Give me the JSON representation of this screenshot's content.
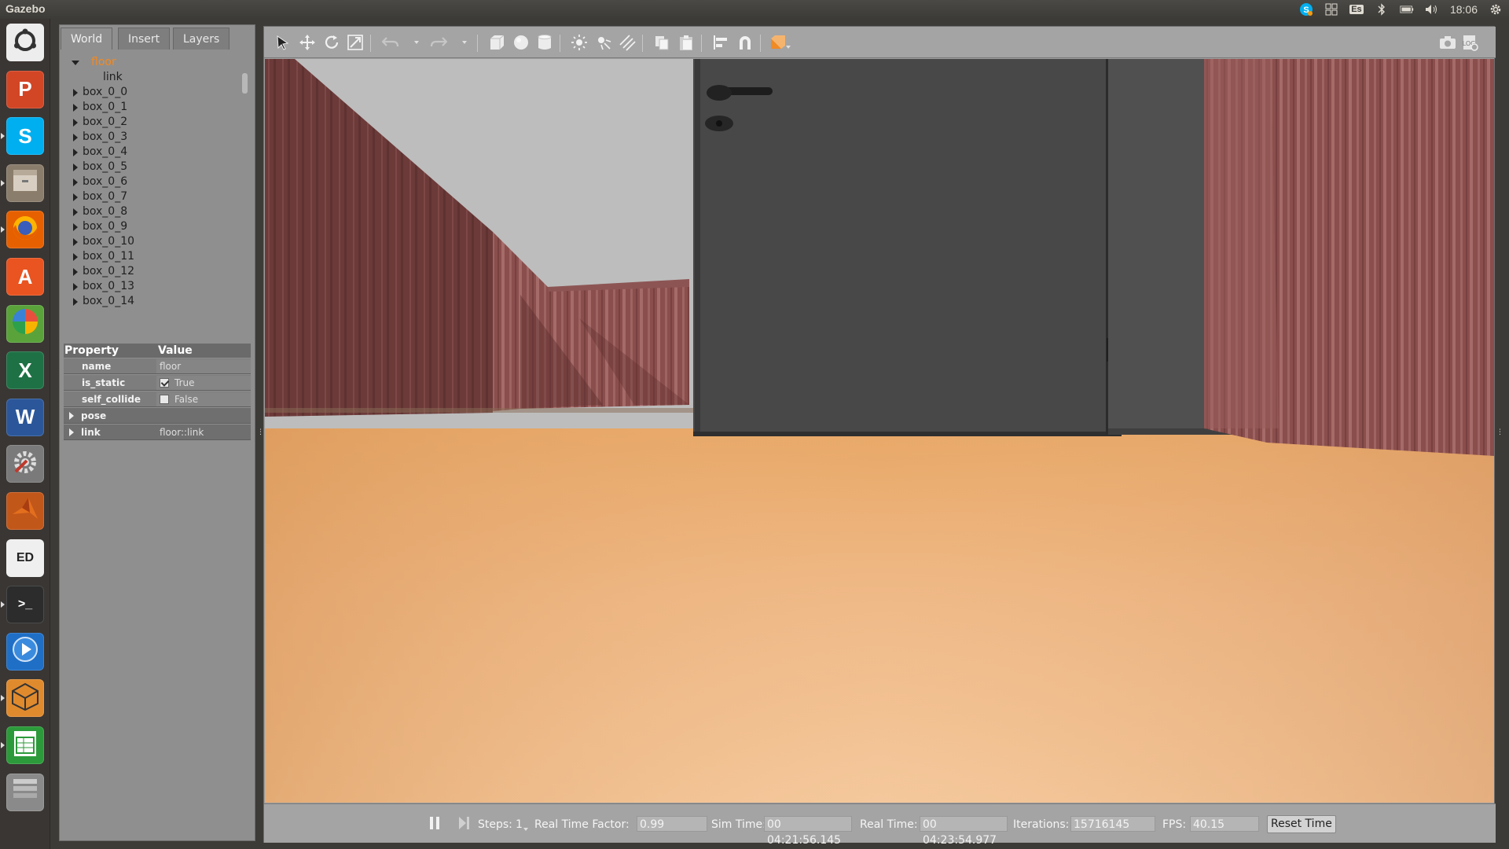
{
  "panel": {
    "app_title": "Gazebo",
    "clock": "18:06",
    "keyboard_layout": "Es"
  },
  "launcher": {
    "items": [
      {
        "name": "Dash home",
        "icon": "ubuntu-dash-icon",
        "color": "#ededed"
      },
      {
        "name": "PowerPoint",
        "icon": "powerpoint-icon",
        "color": "#d24625",
        "glyph": "P"
      },
      {
        "name": "Skype",
        "icon": "skype-icon",
        "color": "#00aff0",
        "glyph": "S"
      },
      {
        "name": "Files",
        "icon": "files-icon",
        "color": "#8b7d6b"
      },
      {
        "name": "Firefox",
        "icon": "firefox-icon",
        "color": "#e66000"
      },
      {
        "name": "Ubuntu Software",
        "icon": "software-center-icon",
        "color": "#e95420",
        "glyph": "A"
      },
      {
        "name": "Photos",
        "icon": "pinwheel-icon",
        "color": "#5aa33b"
      },
      {
        "name": "Excel",
        "icon": "excel-icon",
        "color": "#1e7145",
        "glyph": "X"
      },
      {
        "name": "Word",
        "icon": "word-icon",
        "color": "#2b579a",
        "glyph": "W"
      },
      {
        "name": "System Settings",
        "icon": "settings-icon",
        "color": "#7a7a7a"
      },
      {
        "name": "MATLAB",
        "icon": "matlab-icon",
        "color": "#c2571a"
      },
      {
        "name": "PDF Editor",
        "icon": "pdf-editor-icon",
        "color": "#efefef",
        "glyph": "ED"
      },
      {
        "name": "Terminal",
        "icon": "terminal-icon",
        "color": "#2c2c2c",
        "glyph": ">_"
      },
      {
        "name": "Media Player",
        "icon": "media-player-icon",
        "color": "#1f6fc6"
      },
      {
        "name": "Gazebo",
        "icon": "gazebo-icon",
        "color": "#e08a2e"
      },
      {
        "name": "Spreadsheet",
        "icon": "spreadsheet-icon",
        "color": "#2c9a3a"
      },
      {
        "name": "Workspaces",
        "icon": "workspace-stack-icon",
        "color": "#8a8a8a"
      }
    ]
  },
  "left_panel": {
    "tabs": [
      "World",
      "Insert",
      "Layers"
    ],
    "active_tab": "World",
    "tree": {
      "root": "floor",
      "child": "link",
      "items": [
        "box_0_0",
        "box_0_1",
        "box_0_2",
        "box_0_3",
        "box_0_4",
        "box_0_5",
        "box_0_6",
        "box_0_7",
        "box_0_8",
        "box_0_9",
        "box_0_10",
        "box_0_11",
        "box_0_12",
        "box_0_13",
        "box_0_14"
      ]
    },
    "properties": {
      "header_property": "Property",
      "header_value": "Value",
      "rows": [
        {
          "key": "name",
          "value": "floor",
          "type": "text"
        },
        {
          "key": "is_static",
          "value": "True",
          "type": "checkbox",
          "checked": true
        },
        {
          "key": "self_collide",
          "value": "False",
          "type": "checkbox",
          "checked": false
        },
        {
          "key": "pose",
          "value": "",
          "type": "expandable"
        },
        {
          "key": "link",
          "value": "floor::link",
          "type": "expandable"
        }
      ]
    }
  },
  "toolbar": {
    "buttons": [
      "select-mode-icon",
      "translate-mode-icon",
      "rotate-mode-icon",
      "scale-mode-icon",
      "undo-icon",
      "redo-icon",
      "box-shape-icon",
      "sphere-shape-icon",
      "cylinder-shape-icon",
      "point-light-icon",
      "spot-light-icon",
      "directional-light-icon",
      "copy-icon",
      "paste-icon",
      "align-icon",
      "snap-magnet-icon",
      "view-angle-icon",
      "screenshot-icon",
      "log-icon"
    ]
  },
  "status_bar": {
    "steps_label": "Steps:",
    "steps_value": "1",
    "rtf_label": "Real Time Factor:",
    "rtf_value": "0.99",
    "sim_time_label": "Sim Time:",
    "sim_time_value": "00 04:21:56.145",
    "real_time_label": "Real Time:",
    "real_time_value": "00 04:23:54.977",
    "iterations_label": "Iterations:",
    "iterations_value": "15716145",
    "fps_label": "FPS:",
    "fps_value": "40.15",
    "reset_label": "Reset Time"
  }
}
